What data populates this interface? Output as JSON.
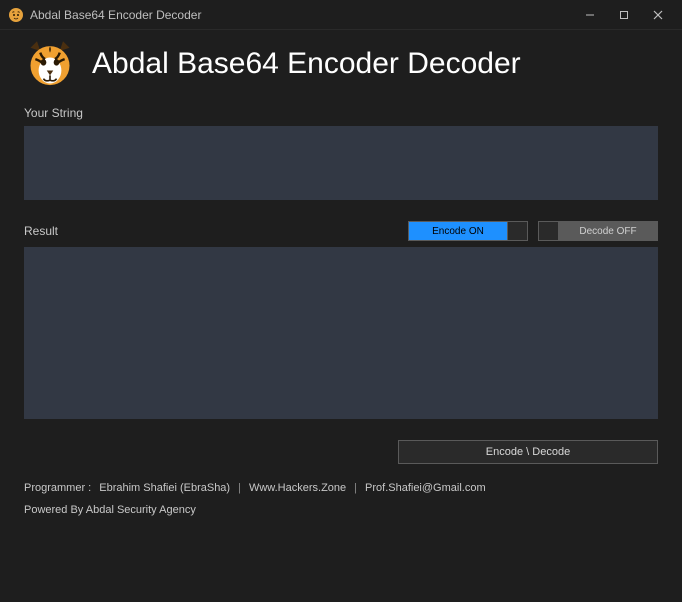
{
  "window": {
    "title": "Abdal Base64 Encoder Decoder"
  },
  "header": {
    "title": "Abdal Base64 Encoder Decoder"
  },
  "input": {
    "label": "Your String",
    "value": ""
  },
  "result": {
    "label": "Result",
    "value": ""
  },
  "toggles": {
    "encode": "Encode ON",
    "decode": "Decode OFF"
  },
  "action": {
    "button": "Encode \\ Decode"
  },
  "footer": {
    "programmer_label": "Programmer :",
    "programmer_name": "Ebrahim Shafiei (EbraSha)",
    "website": "Www.Hackers.Zone",
    "email": "Prof.Shafiei@Gmail.com",
    "powered": "Powered By Abdal Security Agency"
  }
}
